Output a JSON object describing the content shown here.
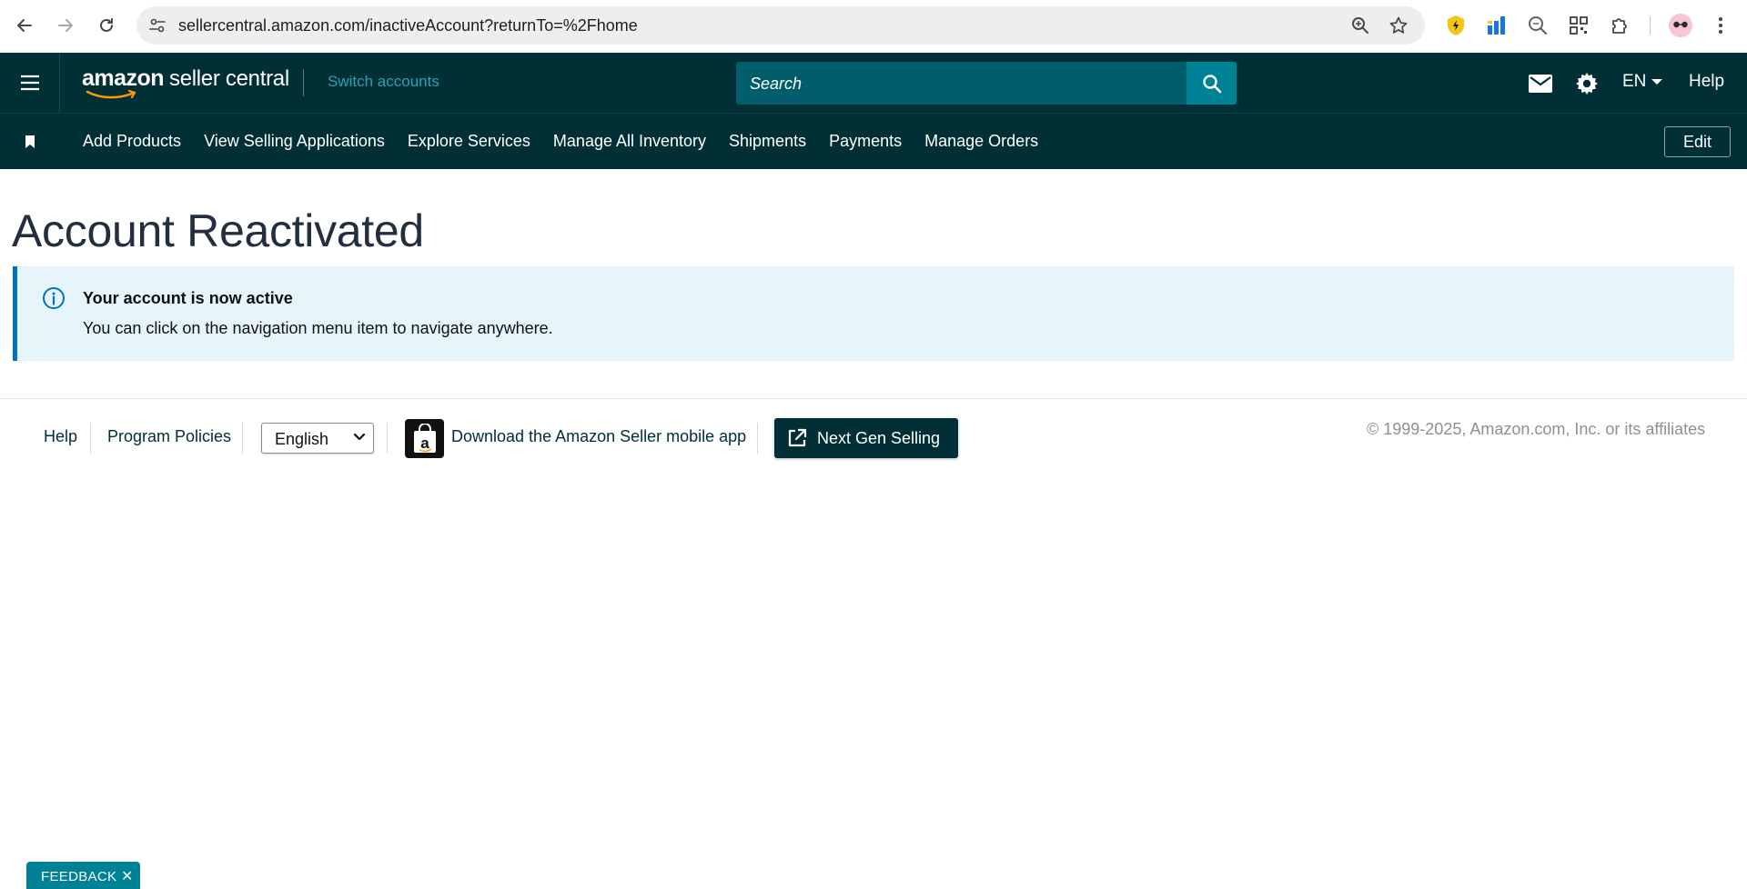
{
  "browser": {
    "url": "sellercentral.amazon.com/inactiveAccount?returnTo=%2Fhome"
  },
  "header": {
    "logo_amazon": "amazon",
    "logo_product": "seller central",
    "switch_accounts": "Switch accounts",
    "search_placeholder": "Search",
    "language": "EN",
    "help": "Help"
  },
  "nav": {
    "items": [
      {
        "label": "Add Products"
      },
      {
        "label": "View Selling Applications"
      },
      {
        "label": "Explore Services"
      },
      {
        "label": "Manage All Inventory"
      },
      {
        "label": "Shipments"
      },
      {
        "label": "Payments"
      },
      {
        "label": "Manage Orders"
      }
    ],
    "edit": "Edit"
  },
  "main": {
    "title": "Account Reactivated",
    "alert": {
      "title": "Your account is now active",
      "body": "You can click on the navigation menu item to navigate anywhere."
    }
  },
  "footer": {
    "help": "Help",
    "program_policies": "Program Policies",
    "language_selected": "English",
    "download_app": "Download the Amazon Seller mobile app",
    "next_gen": "Next Gen Selling",
    "copyright": "© 1999-2025, Amazon.com, Inc. or its affiliates"
  },
  "feedback": {
    "label": "FEEDBACK",
    "close": "✕"
  },
  "colors": {
    "header_bg": "#002f36",
    "search_bg": "#005e6c",
    "search_button": "#008296",
    "alert_bg": "#e6f5fc",
    "alert_border": "#0073bb",
    "switch_accounts": "#2e9fb8"
  },
  "icons": [
    "back-icon",
    "forward-icon",
    "reload-icon",
    "site-info-icon",
    "zoom-icon",
    "star-icon",
    "shield-extension-icon",
    "chart-extension-icon",
    "search-extension-icon",
    "qr-extension-icon",
    "puzzle-icon",
    "profile-avatar",
    "kebab-menu-icon",
    "hamburger-icon",
    "search-icon",
    "mail-icon",
    "gear-icon",
    "caret-down-icon",
    "bookmark-icon",
    "info-icon",
    "external-link-icon",
    "amazon-app-icon"
  ]
}
